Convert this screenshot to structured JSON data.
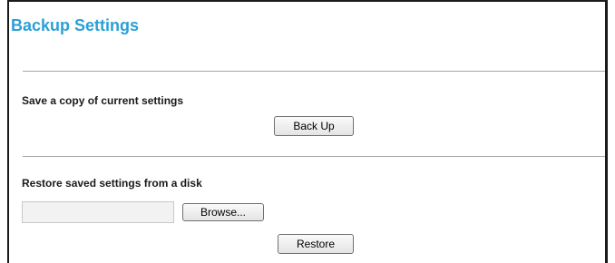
{
  "page": {
    "title": "Backup Settings"
  },
  "backup_section": {
    "label": "Save a copy of current settings",
    "button_label": "Back Up"
  },
  "restore_section": {
    "label": "Restore saved settings from a disk",
    "file_value": "",
    "browse_label": "Browse...",
    "restore_label": "Restore"
  },
  "colors": {
    "title": "#2c9fd6",
    "divider": "#a6a6a6",
    "frame_border": "#1a1a1a"
  }
}
